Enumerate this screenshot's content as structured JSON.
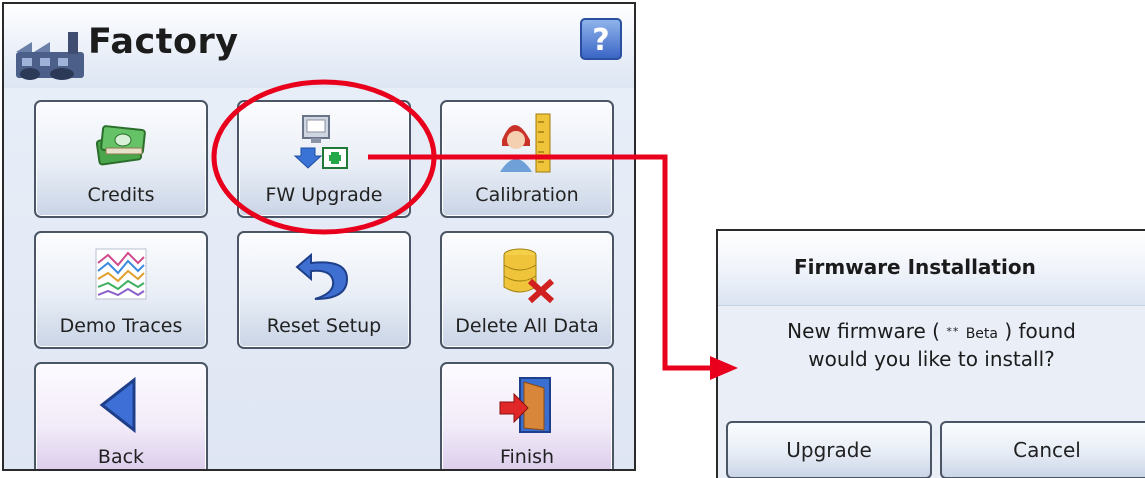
{
  "factory": {
    "title": "Factory",
    "help_label": "?",
    "buttons": [
      {
        "label": "Credits",
        "icon": "money-icon"
      },
      {
        "label": "FW Upgrade",
        "icon": "firmware-upgrade-icon"
      },
      {
        "label": "Calibration",
        "icon": "calibration-icon"
      },
      {
        "label": "Demo Traces",
        "icon": "demo-traces-icon"
      },
      {
        "label": "Reset Setup",
        "icon": "undo-arrow-icon"
      },
      {
        "label": "Delete All Data",
        "icon": "delete-database-icon"
      },
      {
        "label": "Back",
        "icon": "back-arrow-icon"
      },
      {
        "label": "Finish",
        "icon": "exit-door-icon"
      }
    ]
  },
  "dialog": {
    "title": "Firmware Installation",
    "message_line1_prefix": "New firmware (",
    "message_stars": "**",
    "message_beta": "Beta",
    "message_line1_suffix": ") found",
    "message_line2": "would you like to install?",
    "upgrade_label": "Upgrade",
    "cancel_label": "Cancel"
  },
  "colors": {
    "annotation_red": "#e8001c",
    "help_blue": "#3b66c6"
  }
}
